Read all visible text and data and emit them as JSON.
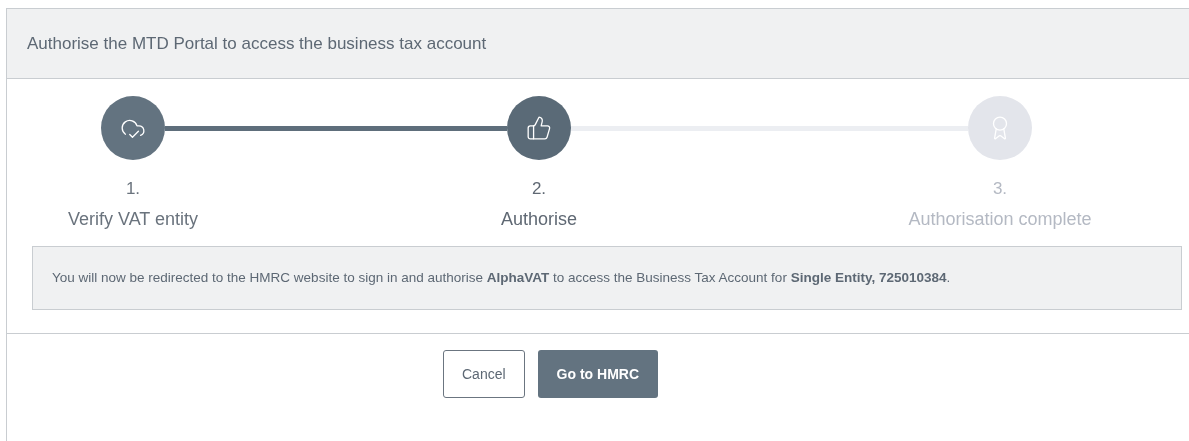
{
  "dialog": {
    "title": "Authorise the MTD Portal to access the business tax account"
  },
  "steps": [
    {
      "number": "1.",
      "label": "Verify VAT entity",
      "completed": true,
      "selected": false
    },
    {
      "number": "2.",
      "label": "Authorise",
      "completed": false,
      "selected": true
    },
    {
      "number": "3.",
      "label": "Authorisation complete",
      "completed": false,
      "selected": false
    }
  ],
  "notice": "You will now be redirected to the HMRC website to sign in and authorise **AlphaVAT** to access the Business Tax Account for **Single Entity, 725010384**.",
  "buttons": [
    {
      "label": "Cancel",
      "kind": "secondary"
    },
    {
      "label": "Go to HMRC",
      "kind": "primary"
    }
  ]
}
